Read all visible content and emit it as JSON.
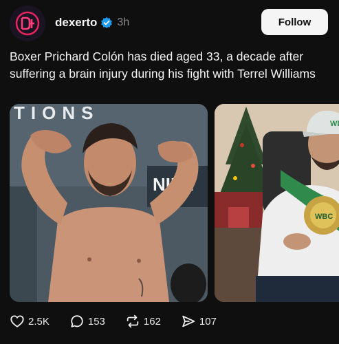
{
  "post": {
    "username": "dexerto",
    "time": "3h",
    "follow_label": "Follow",
    "text": "Boxer Prichard Colón has died aged 33, a decade after suffering a brain injury during his fight with Terrel Williams",
    "photo1_backdrop_text": "TIONS",
    "photo1_banner_text": "NIEL",
    "photo2_belt_text": "WBC",
    "photo2_cap_text": "WBC",
    "verified_color": "#1d9bf0",
    "brand_color": "#e8245e"
  },
  "actions": {
    "likes": "2.5K",
    "comments": "153",
    "reposts": "162",
    "shares": "107"
  }
}
